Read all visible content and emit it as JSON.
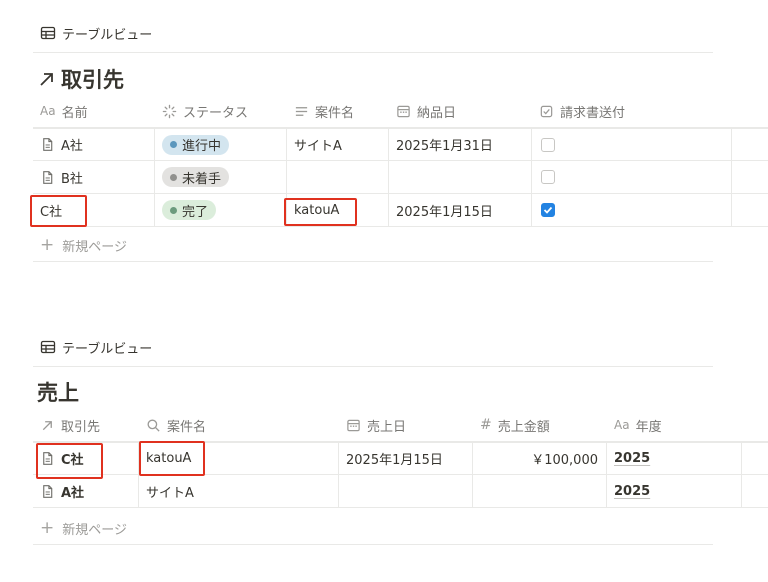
{
  "section1": {
    "view_label": "テーブルビュー",
    "title": "取引先",
    "columns": [
      "名前",
      "ステータス",
      "案件名",
      "納品日",
      "請求書送付"
    ],
    "name_col_icon_text": "Aa",
    "rows": [
      {
        "name": "A社",
        "status": "進行中",
        "status_color": "#d3e5ef",
        "project": "サイトA",
        "delivery": "2025年1月31日",
        "invoice_sent": false
      },
      {
        "name": "B社",
        "status": "未着手",
        "status_color": "#e3e2e0",
        "project": "",
        "delivery": "",
        "invoice_sent": false
      },
      {
        "name": "C社",
        "status": "完了",
        "status_color": "#dbeddb",
        "project": "katouA",
        "delivery": "2025年1月15日",
        "invoice_sent": true
      }
    ],
    "new_page_label": "新規ページ"
  },
  "section2": {
    "view_label": "テーブルビュー",
    "title": "売上",
    "columns": [
      "取引先",
      "案件名",
      "売上日",
      "売上金額",
      "年度"
    ],
    "year_col_icon_text": "Aa",
    "amount_col_icon_text": "#",
    "rows": [
      {
        "client": "C社",
        "project": "katouA",
        "sales_date": "2025年1月15日",
        "amount": "￥100,000",
        "year": "2025"
      },
      {
        "client": "A社",
        "project": "サイトA",
        "sales_date": "",
        "amount": "",
        "year": "2025"
      }
    ],
    "new_page_label": "新規ページ"
  },
  "colors": {
    "highlight_box": "#e0311f",
    "checkbox_checked": "#2383e2",
    "text_primary": "#37352f",
    "text_muted": "#787774"
  }
}
